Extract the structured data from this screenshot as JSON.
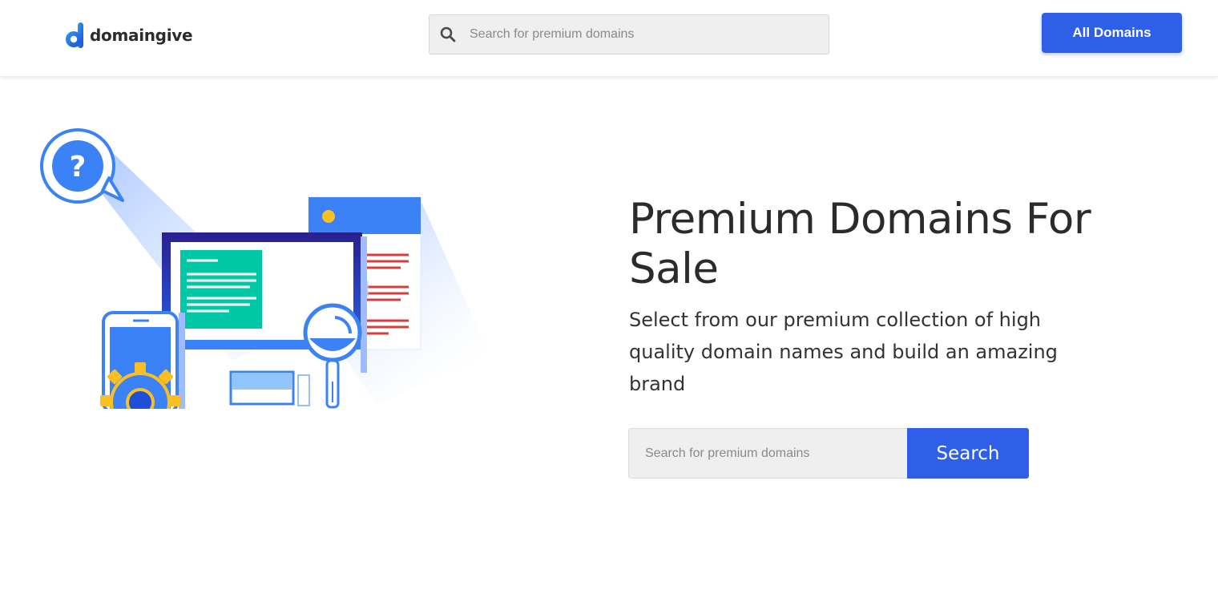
{
  "header": {
    "logo_text": "domaingive",
    "search": {
      "placeholder": "Search for premium domains",
      "value": ""
    },
    "all_domains_label": "All Domains"
  },
  "hero": {
    "title": "Premium Domains For Sale",
    "subtitle": "Select from our premium collection of high quality domain names and build an amazing brand",
    "search": {
      "placeholder": "Search for premium domains",
      "value": ""
    },
    "search_button_label": "Search"
  },
  "icons": {
    "logo": "letter-d-logo-icon",
    "header_search": "search-icon",
    "illustration": "devices-search-illustration"
  },
  "colors": {
    "accent": "#2f5fe8",
    "brand_blue": "#3b82f6",
    "text": "#2b2b2b",
    "input_bg": "#efefef"
  }
}
